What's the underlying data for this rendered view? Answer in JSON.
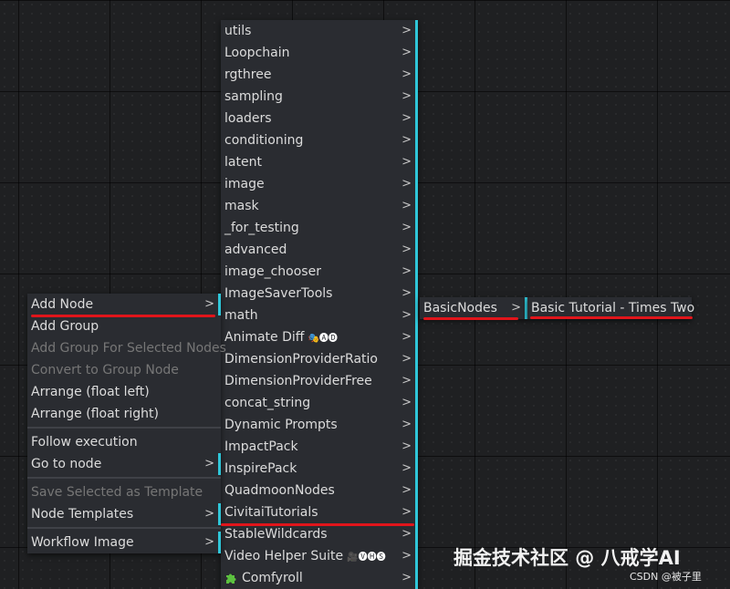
{
  "main_menu": {
    "items": [
      {
        "label": "utils"
      },
      {
        "label": "Loopchain"
      },
      {
        "label": "rgthree"
      },
      {
        "label": "sampling"
      },
      {
        "label": "loaders"
      },
      {
        "label": "conditioning"
      },
      {
        "label": "latent"
      },
      {
        "label": "image"
      },
      {
        "label": "mask"
      },
      {
        "label": "_for_testing"
      },
      {
        "label": "advanced"
      },
      {
        "label": "image_chooser"
      },
      {
        "label": "ImageSaverTools"
      },
      {
        "label": "math"
      },
      {
        "label": "Animate Diff",
        "badge": "🎭🅐🅓"
      },
      {
        "label": "DimensionProviderRatio"
      },
      {
        "label": "DimensionProviderFree"
      },
      {
        "label": "concat_string"
      },
      {
        "label": "Dynamic Prompts"
      },
      {
        "label": "ImpactPack"
      },
      {
        "label": "InspirePack"
      },
      {
        "label": "QuadmoonNodes"
      },
      {
        "label": "CivitaiTutorials"
      },
      {
        "label": "StableWildcards"
      },
      {
        "label": "Video Helper Suite",
        "badge": "🎥🅥🅗🅢"
      },
      {
        "label": "Comfyroll"
      }
    ],
    "arrow": ">"
  },
  "context_menu": {
    "items": [
      {
        "label": "Add Node"
      },
      {
        "label": "Add Group"
      },
      {
        "label": "Add Group For Selected Nodes"
      },
      {
        "label": "Convert to Group Node"
      },
      {
        "label": "Arrange (float left)"
      },
      {
        "label": "Arrange (float right)"
      },
      {
        "label": "Follow execution"
      },
      {
        "label": "Go to node"
      },
      {
        "label": "Save Selected as Template"
      },
      {
        "label": "Node Templates"
      },
      {
        "label": "Workflow Image"
      }
    ],
    "arrow": ">"
  },
  "basic_nodes_menu": {
    "items": [
      {
        "label": "BasicNodes"
      }
    ],
    "arrow": ">"
  },
  "tutorial_menu": {
    "items": [
      {
        "label": "Basic Tutorial - Times Two"
      }
    ]
  },
  "watermark": {
    "main": "掘金技术社区 @ 八戒学AI",
    "sub": "CSDN @被子里"
  },
  "colors": {
    "background": "#1f2022",
    "menu_bg": "#2a2c31",
    "submenu_accent": "#2fc6d8",
    "highlight_underline": "#e1151b"
  }
}
